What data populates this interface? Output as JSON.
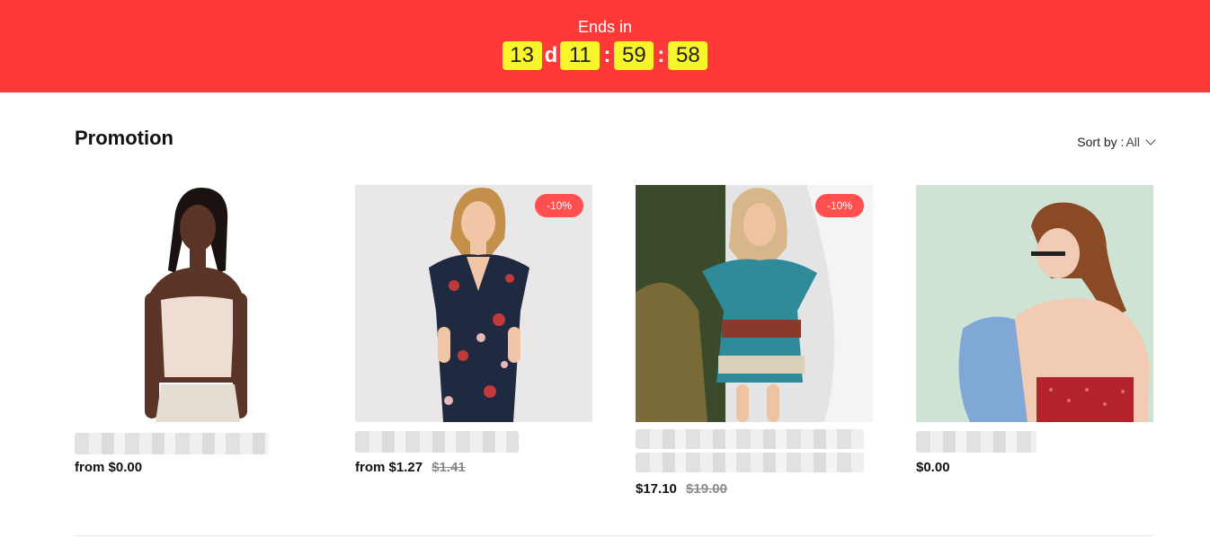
{
  "banner": {
    "label": "Ends in",
    "days": "13",
    "days_unit": "d",
    "hours": "11",
    "minutes": "59",
    "seconds": "58",
    "separator": ":"
  },
  "section": {
    "title": "Promotion"
  },
  "sort": {
    "label": "Sort by :",
    "value": "All"
  },
  "products": [
    {
      "price_prefix": "from",
      "price": "$0.00",
      "old_price": "",
      "badge": ""
    },
    {
      "price_prefix": "from",
      "price": "$1.27",
      "old_price": "$1.41",
      "badge": "-10%"
    },
    {
      "price_prefix": "",
      "price": "$17.10",
      "old_price": "$19.00",
      "badge": "-10%"
    },
    {
      "price_prefix": "",
      "price": "$0.00",
      "old_price": "",
      "badge": ""
    }
  ],
  "colors": {
    "banner": "#ff3838",
    "countdown_box": "#f8f52a",
    "badge": "#ff4f4f"
  }
}
